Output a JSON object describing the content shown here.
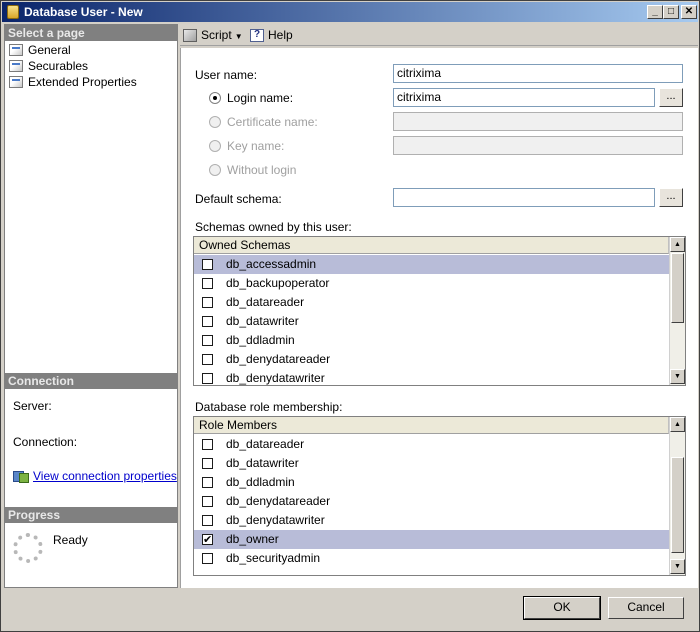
{
  "window": {
    "title": "Database User - New"
  },
  "left": {
    "select_page_header": "Select a page",
    "pages": [
      {
        "label": "General"
      },
      {
        "label": "Securables"
      },
      {
        "label": "Extended Properties"
      }
    ],
    "connection_header": "Connection",
    "server_label": "Server:",
    "connection_label": "Connection:",
    "view_connection_link": "View connection properties",
    "progress_header": "Progress",
    "progress_status": "Ready"
  },
  "toolbar": {
    "script_label": "Script",
    "help_label": "Help"
  },
  "form": {
    "user_name_label": "User name:",
    "user_name_value": "citrixima",
    "login_name_label": "Login name:",
    "login_name_value": "citrixima",
    "certificate_name_label": "Certificate name:",
    "key_name_label": "Key name:",
    "without_login_label": "Without login",
    "default_schema_label": "Default schema:",
    "default_schema_value": "",
    "browse_label": "...",
    "schemas_owned_label": "Schemas owned by this user:",
    "schemas_column": "Owned Schemas",
    "schemas": [
      {
        "name": "db_accessadmin",
        "checked": false
      },
      {
        "name": "db_backupoperator",
        "checked": false
      },
      {
        "name": "db_datareader",
        "checked": false
      },
      {
        "name": "db_datawriter",
        "checked": false
      },
      {
        "name": "db_ddladmin",
        "checked": false
      },
      {
        "name": "db_denydatareader",
        "checked": false
      },
      {
        "name": "db_denydatawriter",
        "checked": false
      }
    ],
    "role_membership_label": "Database role membership:",
    "roles_column": "Role Members",
    "roles": [
      {
        "name": "db_datareader",
        "checked": false
      },
      {
        "name": "db_datawriter",
        "checked": false
      },
      {
        "name": "db_ddladmin",
        "checked": false
      },
      {
        "name": "db_denydatareader",
        "checked": false
      },
      {
        "name": "db_denydatawriter",
        "checked": false
      },
      {
        "name": "db_owner",
        "checked": true
      },
      {
        "name": "db_securityadmin",
        "checked": false
      }
    ]
  },
  "buttons": {
    "ok": "OK",
    "cancel": "Cancel"
  }
}
